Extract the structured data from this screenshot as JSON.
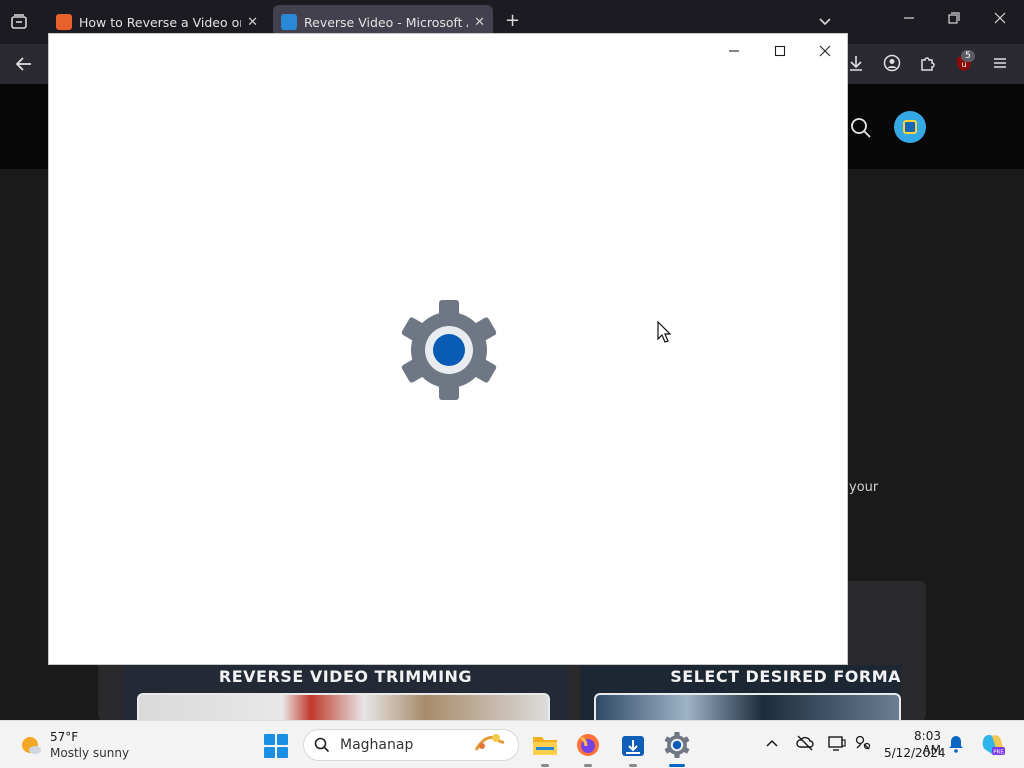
{
  "browser": {
    "tabs": [
      {
        "title": "How to Reverse a Video on Cap",
        "active": false,
        "favicon_color": "#e8612c"
      },
      {
        "title": "Reverse Video - Microsoft Apps",
        "active": true,
        "favicon_color": "#2b88d8"
      }
    ],
    "extension_badge": "5",
    "icons": {
      "tab_list": "tab-list-icon",
      "new_tab": "plus-icon",
      "list_all_tabs": "chevron-down-icon",
      "back": "back-arrow-icon",
      "downloads": "download-icon",
      "account": "account-icon",
      "extensions": "puzzle-icon",
      "menu": "hamburger-icon"
    }
  },
  "store_page": {
    "peek_text": "your",
    "screenshots": [
      {
        "label": "REVERSE VIDEO TRIMMING"
      },
      {
        "label": "SELECT DESIRED FORMA"
      }
    ]
  },
  "settings_window": {
    "splash_icon": "settings-gear-icon",
    "accent": "#0a5bb5"
  },
  "taskbar": {
    "weather": {
      "temp": "57°F",
      "condition": "Mostly sunny"
    },
    "search_placeholder": "Maghanap",
    "apps": [
      "file-explorer-icon",
      "firefox-icon",
      "installer-icon",
      "settings-icon"
    ],
    "clock": {
      "time": "8:03 AM",
      "date": "5/12/2024"
    },
    "copilot_label": "PRE"
  }
}
